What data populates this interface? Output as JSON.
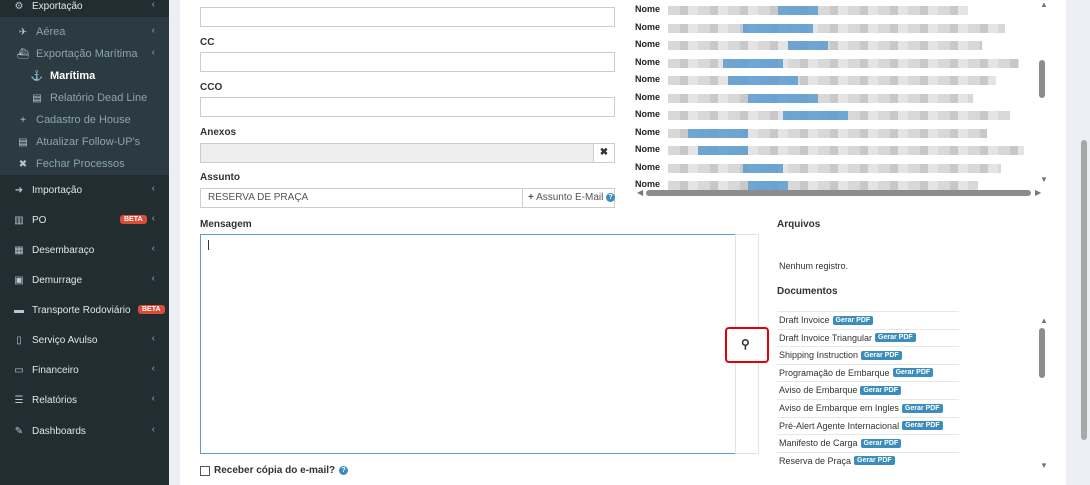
{
  "sidebar": {
    "items": [
      {
        "label": "Exportação",
        "icon": "gear-icon",
        "glyph": "⚙",
        "level": "top",
        "chevron": true
      },
      {
        "label": "Aérea",
        "icon": "plane-icon",
        "glyph": "✈",
        "level": "sub",
        "chevron": true
      },
      {
        "label": "Exportação Marítima",
        "icon": "ship-icon",
        "glyph": "⛴",
        "level": "sub",
        "chevron": true
      },
      {
        "label": "Marítima",
        "icon": "captain-icon",
        "glyph": "⚓",
        "level": "active",
        "chevron": false
      },
      {
        "label": "Relatório Dead Line",
        "icon": "report-icon",
        "glyph": "▤",
        "level": "sub2",
        "chevron": false
      },
      {
        "label": "Cadastro de House",
        "icon": "plus-icon",
        "glyph": "+",
        "level": "sub",
        "chevron": false
      },
      {
        "label": "Atualizar Follow-UP's",
        "icon": "list-icon",
        "glyph": "▤",
        "level": "sub",
        "chevron": false
      },
      {
        "label": "Fechar Processos",
        "icon": "close-icon",
        "glyph": "✖",
        "level": "sub",
        "chevron": false
      },
      {
        "label": "Importação",
        "icon": "arrow-circle-icon",
        "glyph": "➜",
        "level": "top",
        "chevron": true
      },
      {
        "label": "PO",
        "icon": "bar-chart-icon",
        "glyph": "▥",
        "level": "top",
        "chevron": true,
        "badge": "BETA"
      },
      {
        "label": "Desembaraço",
        "icon": "calculator-icon",
        "glyph": "▦",
        "level": "top",
        "chevron": true
      },
      {
        "label": "Demurrage",
        "icon": "calendar-icon",
        "glyph": "▣",
        "level": "top",
        "chevron": true
      },
      {
        "label": "Transporte Rodoviário",
        "icon": "bus-icon",
        "glyph": "▬",
        "level": "top",
        "chevron": false,
        "badge": "BETA"
      },
      {
        "label": "Serviço Avulso",
        "icon": "file-icon",
        "glyph": "▯",
        "level": "top",
        "chevron": true
      },
      {
        "label": "Financeiro",
        "icon": "money-icon",
        "glyph": "▭",
        "level": "top",
        "chevron": true
      },
      {
        "label": "Relatórios",
        "icon": "database-icon",
        "glyph": "☰",
        "level": "top",
        "chevron": true
      },
      {
        "label": "Dashboards",
        "icon": "edit-icon",
        "glyph": "✎",
        "level": "top",
        "chevron": true
      }
    ]
  },
  "form": {
    "to_value": "",
    "cc_label": "CC",
    "cc_value": "",
    "cco_label": "CCO",
    "cco_value": "",
    "anexos_label": "Anexos",
    "anexos_remove": "✖",
    "assunto_label": "Assunto",
    "assunto_value": "RESERVA DE PRAÇA",
    "assunto_email_button": "Assunto E-Mail",
    "assunto_plus": "+",
    "help_glyph": "?",
    "mensagem_label": "Mensagem",
    "copy_checkbox_label": "Receber cópia do e-mail?",
    "search_glyph": "⚲"
  },
  "contacts": {
    "label": "Nome",
    "rows": 11
  },
  "files": {
    "title": "Arquivos",
    "empty_text": "Nenhum registro.",
    "documents_title": "Documentos",
    "gerar_pdf_label": "Gerar PDF",
    "documents": [
      "Draft Invoice",
      "Draft Invoice Triangular",
      "Shipping Instruction",
      "Programação de Embarque",
      "Aviso de Embarque",
      "Aviso de Embarque em Ingles",
      "Pré-Alert Agente Internacional",
      "Manifesto de Carga",
      "Reserva de Praça"
    ]
  },
  "colors": {
    "sidebar_bg": "#222d32",
    "accent": "#3c8dbc",
    "badge": "#dd4b39",
    "highlight": "#e3000b"
  }
}
